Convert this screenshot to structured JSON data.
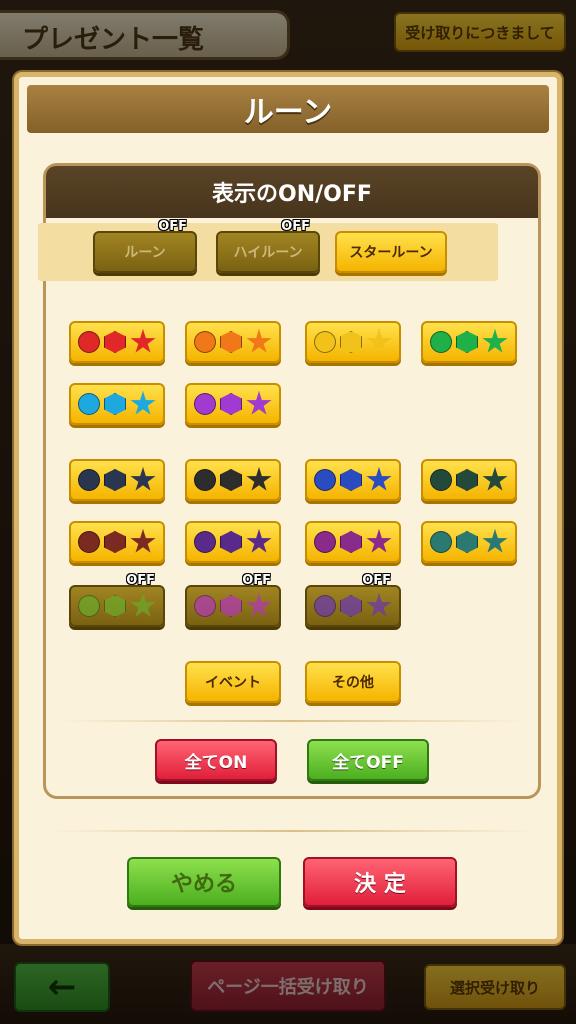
{
  "background": {
    "title": "プレゼント一覧",
    "info_button": "受け取りにつきまして",
    "back_icon": "←",
    "page_receive_button": "ページ一括受け取り",
    "select_receive_button": "選択受け取り"
  },
  "modal": {
    "title": "ルーン",
    "panel_title": "表示のON/OFF",
    "tabs": [
      {
        "label": "ルーン",
        "state": "OFF"
      },
      {
        "label": "ハイルーン",
        "state": "OFF"
      },
      {
        "label": "スタールーン",
        "state": ""
      }
    ],
    "off_label": "OFF",
    "rune_rows": [
      {
        "color": "#e02828",
        "off": false
      },
      {
        "color": "#f07818",
        "off": false
      },
      {
        "color": "#f2c21a",
        "off": false
      },
      {
        "color": "#20b04a",
        "off": false
      },
      {
        "color": "#1ea8e0",
        "off": false
      },
      {
        "color": "#a03ad0",
        "off": false
      },
      {
        "color": "#2a3550",
        "off": false
      },
      {
        "color": "#2d2d2d",
        "off": false
      },
      {
        "color": "#2a4cc0",
        "off": false
      },
      {
        "color": "#23493a",
        "off": false
      },
      {
        "color": "#7a2a20",
        "off": false
      },
      {
        "color": "#5a2a8a",
        "off": false
      },
      {
        "color": "#8a2a8a",
        "off": false
      },
      {
        "color": "#2a7a72",
        "off": false
      },
      {
        "color": "#6ca82a",
        "off": true
      },
      {
        "color": "#b03ab0",
        "off": true
      },
      {
        "color": "#6a3aa8",
        "off": true
      }
    ],
    "event_button": "イベント",
    "other_button": "その他",
    "all_on_button": "全てON",
    "all_off_button": "全てOFF",
    "cancel_button": "やめる",
    "confirm_button": "決 定"
  }
}
